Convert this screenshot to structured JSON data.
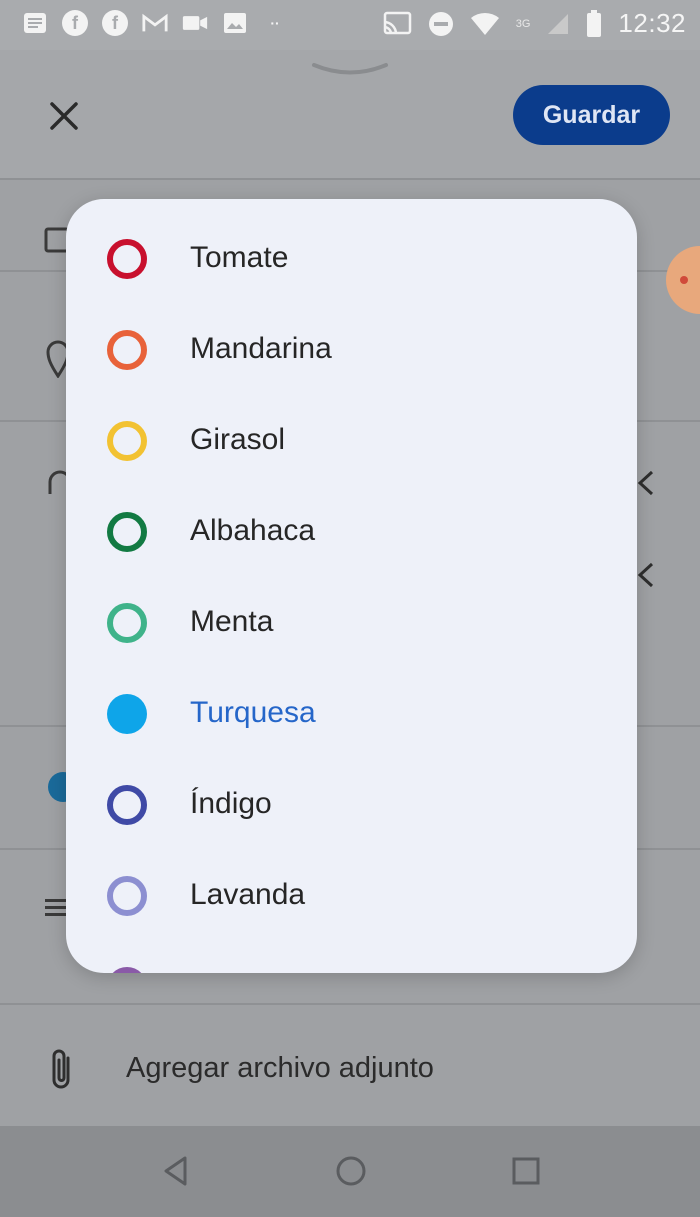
{
  "status_bar": {
    "time": "12:32",
    "network": "3G",
    "icons": [
      "notes-icon",
      "facebook-icon",
      "facebook-icon",
      "gmail-icon",
      "video-icon",
      "image-icon",
      "more-dots-icon",
      "cast-icon",
      "dnd-icon",
      "wifi-icon",
      "signal-icon",
      "battery-icon"
    ]
  },
  "header": {
    "save_label": "Guardar",
    "close_icon": "close-icon"
  },
  "color_menu": {
    "items": [
      {
        "label": "Tomate",
        "color": "#c8102e",
        "selected": false
      },
      {
        "label": "Mandarina",
        "color": "#e8623a",
        "selected": false
      },
      {
        "label": "Girasol",
        "color": "#f2c232",
        "selected": false
      },
      {
        "label": "Albahaca",
        "color": "#127a43",
        "selected": false
      },
      {
        "label": "Menta",
        "color": "#3fb38a",
        "selected": false
      },
      {
        "label": "Turquesa",
        "color": "#0ea5e9",
        "selected": true
      },
      {
        "label": "Índigo",
        "color": "#3f4aa6",
        "selected": false
      },
      {
        "label": "Lavanda",
        "color": "#8c8fd1",
        "selected": false
      }
    ],
    "selected_text_color": "#2566c9"
  },
  "attachment": {
    "label": "Agregar archivo adjunto"
  },
  "nav": {
    "buttons": [
      "back-icon",
      "home-icon",
      "recents-icon"
    ]
  }
}
